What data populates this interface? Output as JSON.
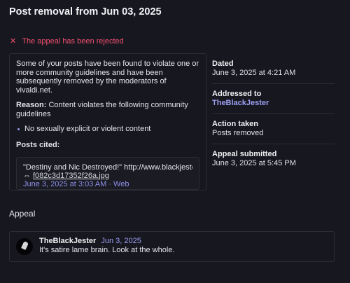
{
  "page_title": "Post removal from Jun 03, 2025",
  "status": {
    "icon": "close-icon",
    "text": "The appeal has been rejected",
    "color": "#f0506e"
  },
  "notice": {
    "intro": "Some of your posts have been found to violate one or more community guidelines and have been subsequently removed by the moderators of vivaldi.net.",
    "reason_label": "Reason:",
    "reason_text": "Content violates the following community guidelines",
    "rules": [
      "No sexually explicit or violent content"
    ],
    "cited_label": "Posts cited:",
    "cited_post": {
      "text": "\"Destiny and Nic Destroyed!\" http://www.blackjester.c",
      "link_icon": "link-icon",
      "link_text": "f082c3d17352f26a.jpg",
      "meta": "June 3, 2025 at 3:03 AM · Web"
    }
  },
  "details": [
    {
      "label": "Dated",
      "value": "June 3, 2025 at 4:21 AM"
    },
    {
      "label": "Addressed to",
      "value": "TheBlackJester",
      "is_user": true
    },
    {
      "label": "Action taken",
      "value": "Posts removed"
    },
    {
      "label": "Appeal submitted",
      "value": "June 3, 2025 at 5:45 PM"
    }
  ],
  "appeal": {
    "heading": "Appeal",
    "author": "TheBlackJester",
    "date": "Jun 3, 2025",
    "message": "It's satire lame brain.  Look at the whole."
  },
  "colors": {
    "background": "#17171f",
    "accent": "#9c9ef4",
    "danger": "#f0506e",
    "border": "#2c2c36"
  }
}
